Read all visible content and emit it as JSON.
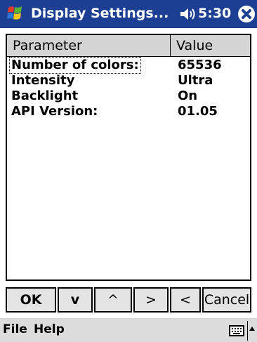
{
  "titlebar": {
    "title": "Display Settings...",
    "time": "5:30",
    "colors": {
      "background": "#1c3f94",
      "text": "#ffffff"
    },
    "icons": {
      "start": "windows-flag-icon",
      "volume": "speaker-icon",
      "close": "close-circle-icon"
    }
  },
  "table": {
    "headers": {
      "parameter": "Parameter",
      "value": "Value"
    },
    "rows": [
      {
        "parameter": "Number of colors:",
        "value": "65536"
      },
      {
        "parameter": "Intensity",
        "value": "Ultra"
      },
      {
        "parameter": "Backlight",
        "value": "On"
      },
      {
        "parameter": "API Version:",
        "value": "01.05"
      }
    ]
  },
  "buttons": {
    "ok": "OK",
    "down": "v",
    "up": "^",
    "next": ">",
    "prev": "<",
    "cancel": "Cancel"
  },
  "menubar": {
    "file": "File",
    "help": "Help",
    "icons": {
      "keyboard": "keyboard-icon",
      "sip": "chevron-up-icon"
    }
  }
}
